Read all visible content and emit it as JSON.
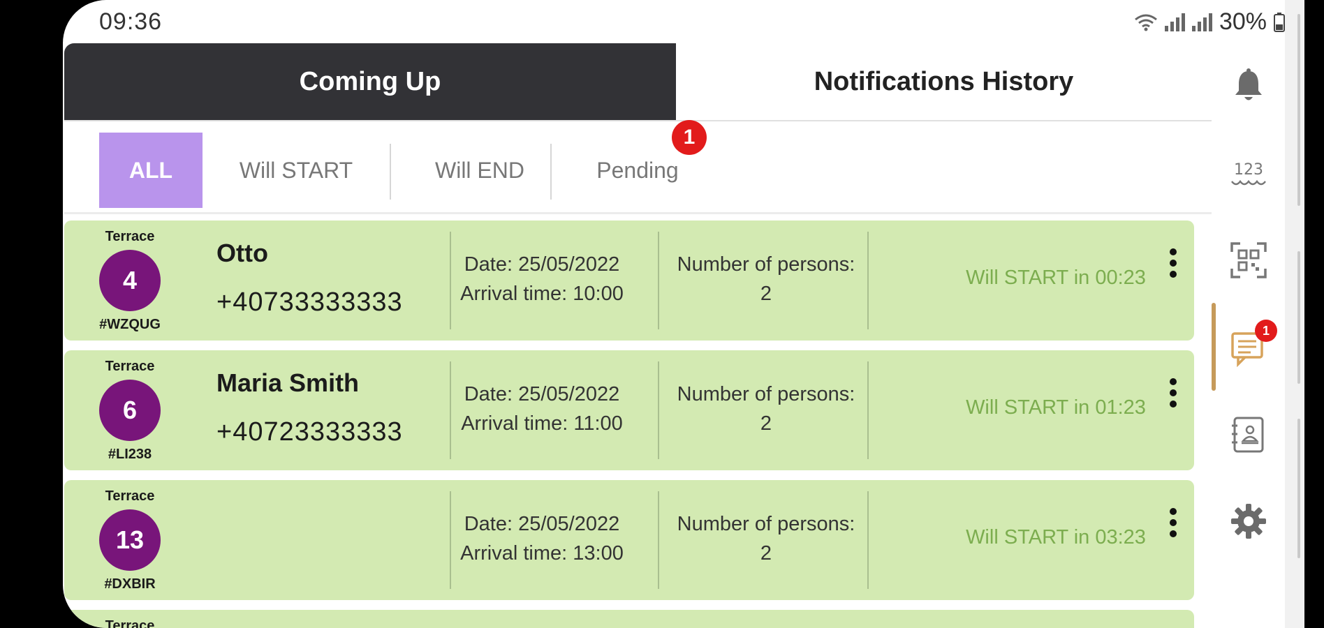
{
  "status_bar": {
    "time": "09:36",
    "battery": "30%"
  },
  "tabs": [
    {
      "label": "Coming Up",
      "active": true
    },
    {
      "label": "Notifications History",
      "active": false
    }
  ],
  "filters": [
    {
      "label": "ALL",
      "active": true
    },
    {
      "label": "Will START"
    },
    {
      "label": "Will END"
    },
    {
      "label": "Pending",
      "badge": "1"
    }
  ],
  "reservations": [
    {
      "zone": "Terrace",
      "table": "4",
      "code": "#WZQUG",
      "name": "Otto",
      "phone": "+40733333333",
      "date": "Date: 25/05/2022",
      "arrival": "Arrival time: 10:00",
      "persons_label": "Number of persons:",
      "persons": "2",
      "status": "Will START in 00:23"
    },
    {
      "zone": "Terrace",
      "table": "6",
      "code": "#LI238",
      "name": "Maria Smith",
      "phone": "+40723333333",
      "date": "Date: 25/05/2022",
      "arrival": "Arrival time: 11:00",
      "persons_label": "Number of persons:",
      "persons": "2",
      "status": "Will START in 01:23"
    },
    {
      "zone": "Terrace",
      "table": "13",
      "code": "#DXBIR",
      "name": "",
      "phone": "",
      "date": "Date: 25/05/2022",
      "arrival": "Arrival time: 13:00",
      "persons_label": "Number of persons:",
      "persons": "2",
      "status": "Will START in 03:23"
    }
  ],
  "partial_row": {
    "zone": "Terrace"
  },
  "sidebar": {
    "items": [
      {
        "icon": "bell-icon"
      },
      {
        "icon": "numbers-icon",
        "label": "123"
      },
      {
        "icon": "qr-code-icon"
      },
      {
        "icon": "reservations-icon",
        "badge": "1",
        "active": true
      },
      {
        "icon": "waiter-book-icon"
      },
      {
        "icon": "gear-icon"
      }
    ]
  },
  "colors": {
    "active_tab": "#323236",
    "filter_active": "#b994ec",
    "row_bg": "#d3eab2",
    "table_circle": "#78157a",
    "status_text": "#7cad4f",
    "badge": "#e21b1b"
  }
}
